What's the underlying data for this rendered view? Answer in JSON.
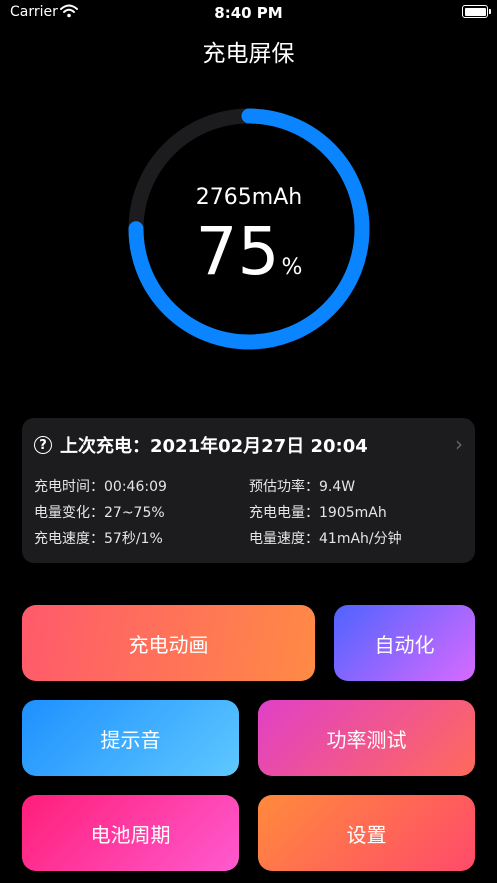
{
  "status_bar": {
    "carrier": "Carrier",
    "time": "8:40 PM",
    "battery_level": 1.0
  },
  "title": "充电屏保",
  "gauge": {
    "capacity": "2765mAh",
    "percent_value": "75",
    "percent_sign": "%",
    "level": 0.75,
    "colors": {
      "progress": "#0a84ff",
      "track": "#1c1c1e"
    }
  },
  "last_charge": {
    "header": "上次充电：2021年02月27日 20:04",
    "stats": [
      {
        "label": "充电时间：",
        "value": "00:46:09"
      },
      {
        "label": "预估功率：",
        "value": "9.4W"
      },
      {
        "label": "电量变化：",
        "value": "27~75%"
      },
      {
        "label": "充电电量：",
        "value": "1905mAh"
      },
      {
        "label": "充电速度：",
        "value": "57秒/1%"
      },
      {
        "label": "电量速度：",
        "value": "41mAh/分钟"
      }
    ]
  },
  "buttons": {
    "charge_animation": "充电动画",
    "automation": "自动化",
    "alert_sound": "提示音",
    "power_test": "功率测试",
    "battery_cycle": "电池周期",
    "settings": "设置"
  },
  "icons": {
    "help": "question-circle-icon",
    "chevron": "chevron-right-icon",
    "wifi": "wifi-icon",
    "battery": "battery-icon"
  }
}
